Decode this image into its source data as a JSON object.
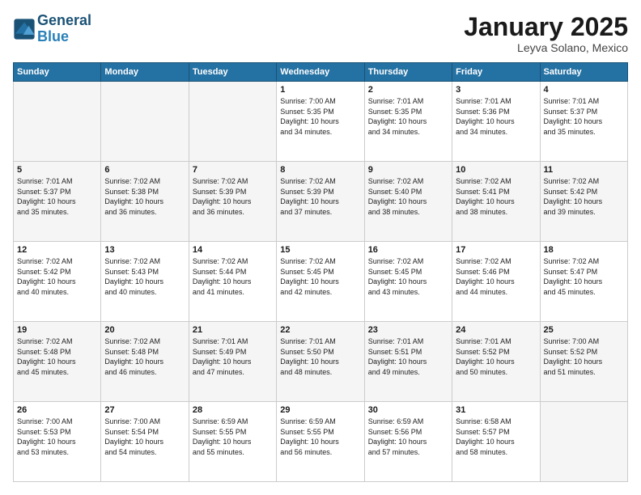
{
  "header": {
    "logo_line1": "General",
    "logo_line2": "Blue",
    "title": "January 2025",
    "subtitle": "Leyva Solano, Mexico"
  },
  "days_of_week": [
    "Sunday",
    "Monday",
    "Tuesday",
    "Wednesday",
    "Thursday",
    "Friday",
    "Saturday"
  ],
  "weeks": [
    [
      {
        "day": "",
        "info": ""
      },
      {
        "day": "",
        "info": ""
      },
      {
        "day": "",
        "info": ""
      },
      {
        "day": "1",
        "info": "Sunrise: 7:00 AM\nSunset: 5:35 PM\nDaylight: 10 hours\nand 34 minutes."
      },
      {
        "day": "2",
        "info": "Sunrise: 7:01 AM\nSunset: 5:35 PM\nDaylight: 10 hours\nand 34 minutes."
      },
      {
        "day": "3",
        "info": "Sunrise: 7:01 AM\nSunset: 5:36 PM\nDaylight: 10 hours\nand 34 minutes."
      },
      {
        "day": "4",
        "info": "Sunrise: 7:01 AM\nSunset: 5:37 PM\nDaylight: 10 hours\nand 35 minutes."
      }
    ],
    [
      {
        "day": "5",
        "info": "Sunrise: 7:01 AM\nSunset: 5:37 PM\nDaylight: 10 hours\nand 35 minutes."
      },
      {
        "day": "6",
        "info": "Sunrise: 7:02 AM\nSunset: 5:38 PM\nDaylight: 10 hours\nand 36 minutes."
      },
      {
        "day": "7",
        "info": "Sunrise: 7:02 AM\nSunset: 5:39 PM\nDaylight: 10 hours\nand 36 minutes."
      },
      {
        "day": "8",
        "info": "Sunrise: 7:02 AM\nSunset: 5:39 PM\nDaylight: 10 hours\nand 37 minutes."
      },
      {
        "day": "9",
        "info": "Sunrise: 7:02 AM\nSunset: 5:40 PM\nDaylight: 10 hours\nand 38 minutes."
      },
      {
        "day": "10",
        "info": "Sunrise: 7:02 AM\nSunset: 5:41 PM\nDaylight: 10 hours\nand 38 minutes."
      },
      {
        "day": "11",
        "info": "Sunrise: 7:02 AM\nSunset: 5:42 PM\nDaylight: 10 hours\nand 39 minutes."
      }
    ],
    [
      {
        "day": "12",
        "info": "Sunrise: 7:02 AM\nSunset: 5:42 PM\nDaylight: 10 hours\nand 40 minutes."
      },
      {
        "day": "13",
        "info": "Sunrise: 7:02 AM\nSunset: 5:43 PM\nDaylight: 10 hours\nand 40 minutes."
      },
      {
        "day": "14",
        "info": "Sunrise: 7:02 AM\nSunset: 5:44 PM\nDaylight: 10 hours\nand 41 minutes."
      },
      {
        "day": "15",
        "info": "Sunrise: 7:02 AM\nSunset: 5:45 PM\nDaylight: 10 hours\nand 42 minutes."
      },
      {
        "day": "16",
        "info": "Sunrise: 7:02 AM\nSunset: 5:45 PM\nDaylight: 10 hours\nand 43 minutes."
      },
      {
        "day": "17",
        "info": "Sunrise: 7:02 AM\nSunset: 5:46 PM\nDaylight: 10 hours\nand 44 minutes."
      },
      {
        "day": "18",
        "info": "Sunrise: 7:02 AM\nSunset: 5:47 PM\nDaylight: 10 hours\nand 45 minutes."
      }
    ],
    [
      {
        "day": "19",
        "info": "Sunrise: 7:02 AM\nSunset: 5:48 PM\nDaylight: 10 hours\nand 45 minutes."
      },
      {
        "day": "20",
        "info": "Sunrise: 7:02 AM\nSunset: 5:48 PM\nDaylight: 10 hours\nand 46 minutes."
      },
      {
        "day": "21",
        "info": "Sunrise: 7:01 AM\nSunset: 5:49 PM\nDaylight: 10 hours\nand 47 minutes."
      },
      {
        "day": "22",
        "info": "Sunrise: 7:01 AM\nSunset: 5:50 PM\nDaylight: 10 hours\nand 48 minutes."
      },
      {
        "day": "23",
        "info": "Sunrise: 7:01 AM\nSunset: 5:51 PM\nDaylight: 10 hours\nand 49 minutes."
      },
      {
        "day": "24",
        "info": "Sunrise: 7:01 AM\nSunset: 5:52 PM\nDaylight: 10 hours\nand 50 minutes."
      },
      {
        "day": "25",
        "info": "Sunrise: 7:00 AM\nSunset: 5:52 PM\nDaylight: 10 hours\nand 51 minutes."
      }
    ],
    [
      {
        "day": "26",
        "info": "Sunrise: 7:00 AM\nSunset: 5:53 PM\nDaylight: 10 hours\nand 53 minutes."
      },
      {
        "day": "27",
        "info": "Sunrise: 7:00 AM\nSunset: 5:54 PM\nDaylight: 10 hours\nand 54 minutes."
      },
      {
        "day": "28",
        "info": "Sunrise: 6:59 AM\nSunset: 5:55 PM\nDaylight: 10 hours\nand 55 minutes."
      },
      {
        "day": "29",
        "info": "Sunrise: 6:59 AM\nSunset: 5:55 PM\nDaylight: 10 hours\nand 56 minutes."
      },
      {
        "day": "30",
        "info": "Sunrise: 6:59 AM\nSunset: 5:56 PM\nDaylight: 10 hours\nand 57 minutes."
      },
      {
        "day": "31",
        "info": "Sunrise: 6:58 AM\nSunset: 5:57 PM\nDaylight: 10 hours\nand 58 minutes."
      },
      {
        "day": "",
        "info": ""
      }
    ]
  ]
}
